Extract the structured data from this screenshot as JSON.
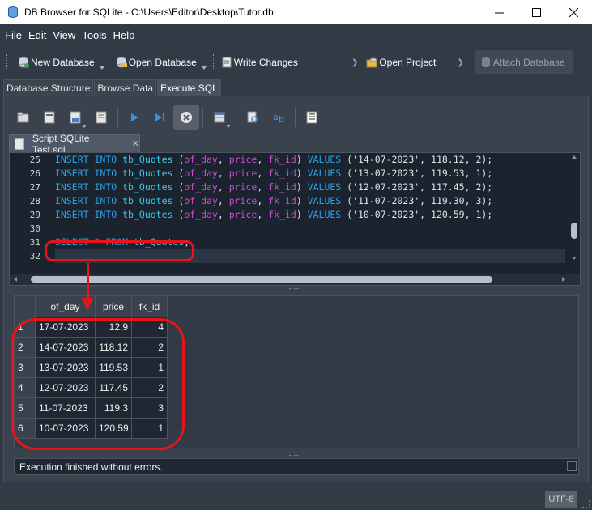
{
  "window": {
    "title": "DB Browser for SQLite - C:\\Users\\Editor\\Desktop\\Tutor.db",
    "minimize_label": "—",
    "maximize_label": "☐",
    "close_label": "✕"
  },
  "menu": [
    "File",
    "Edit",
    "View",
    "Tools",
    "Help"
  ],
  "toolbar": {
    "new_database": "New Database",
    "open_database": "Open Database",
    "write_changes": "Write Changes",
    "open_project": "Open Project",
    "attach_database": "Attach Database"
  },
  "tabs": [
    {
      "label": "Database Structure",
      "active": false
    },
    {
      "label": "Browse Data",
      "active": false
    },
    {
      "label": "Execute SQL",
      "active": true
    }
  ],
  "editor": {
    "tab_label": "Script SQLite Test.sql",
    "line_numbers": [
      "25",
      "26",
      "27",
      "28",
      "29",
      "30",
      "31",
      "32"
    ],
    "insert_rows": [
      {
        "date": "'14-07-2023'",
        "price": "118.12",
        "fk": "2"
      },
      {
        "date": "'13-07-2023'",
        "price": "119.53",
        "fk": "1"
      },
      {
        "date": "'12-07-2023'",
        "price": "117.45",
        "fk": "2"
      },
      {
        "date": "'11-07-2023'",
        "price": "119.30",
        "fk": "3"
      },
      {
        "date": "'10-07-2023'",
        "price": "120.59",
        "fk": "1"
      }
    ],
    "kw_insert": "INSERT",
    "kw_into": "INTO",
    "kw_values": "VALUES",
    "kw_select": "SELECT",
    "kw_from": "FROM",
    "table": "tb_Quotes",
    "col1": "of_day",
    "col2": "price",
    "col3": "fk_id",
    "star": " * "
  },
  "results": {
    "columns": [
      "of_day",
      "price",
      "fk_id"
    ],
    "rows": [
      {
        "n": "1",
        "of_day": "17-07-2023",
        "price": "12.9",
        "fk_id": "4"
      },
      {
        "n": "2",
        "of_day": "14-07-2023",
        "price": "118.12",
        "fk_id": "2"
      },
      {
        "n": "3",
        "of_day": "13-07-2023",
        "price": "119.53",
        "fk_id": "1"
      },
      {
        "n": "4",
        "of_day": "12-07-2023",
        "price": "117.45",
        "fk_id": "2"
      },
      {
        "n": "5",
        "of_day": "11-07-2023",
        "price": "119.3",
        "fk_id": "3"
      },
      {
        "n": "6",
        "of_day": "10-07-2023",
        "price": "120.59",
        "fk_id": "1"
      }
    ]
  },
  "message": "Execution finished without errors.",
  "status": {
    "encoding": "UTF-8"
  },
  "colors": {
    "annotation": "#e8141c",
    "keyword": "#2ba0e8",
    "column": "#c94fd0"
  }
}
